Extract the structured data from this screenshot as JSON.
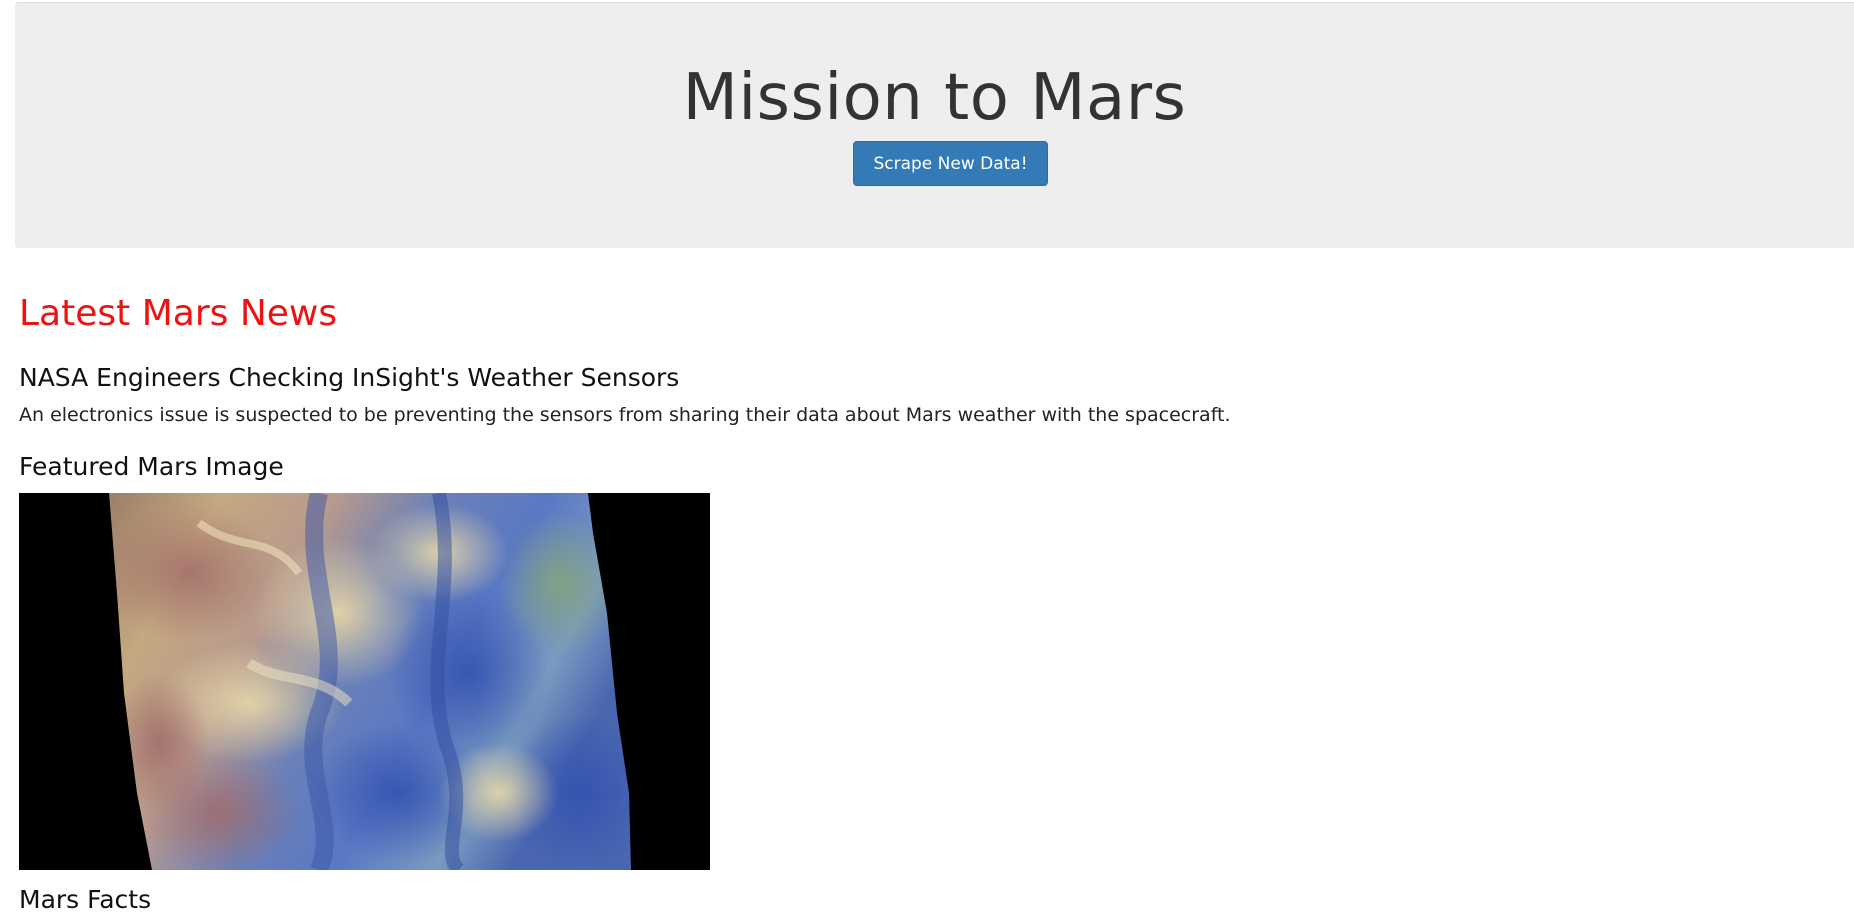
{
  "header": {
    "title": "Mission to Mars",
    "scrape_button_label": "Scrape New Data!"
  },
  "news": {
    "section_heading": "Latest Mars News",
    "title": "NASA Engineers Checking InSight's Weather Sensors",
    "paragraph": "An electronics issue is suspected to be preventing the sensors from sharing their data about Mars weather with the spacecraft."
  },
  "featured_image": {
    "heading": "Featured Mars Image"
  },
  "facts": {
    "heading": "Mars Facts"
  },
  "colors": {
    "jumbotron_bg": "#eeeeee",
    "button_bg": "#337ab7",
    "news_heading": "#ee1111"
  }
}
